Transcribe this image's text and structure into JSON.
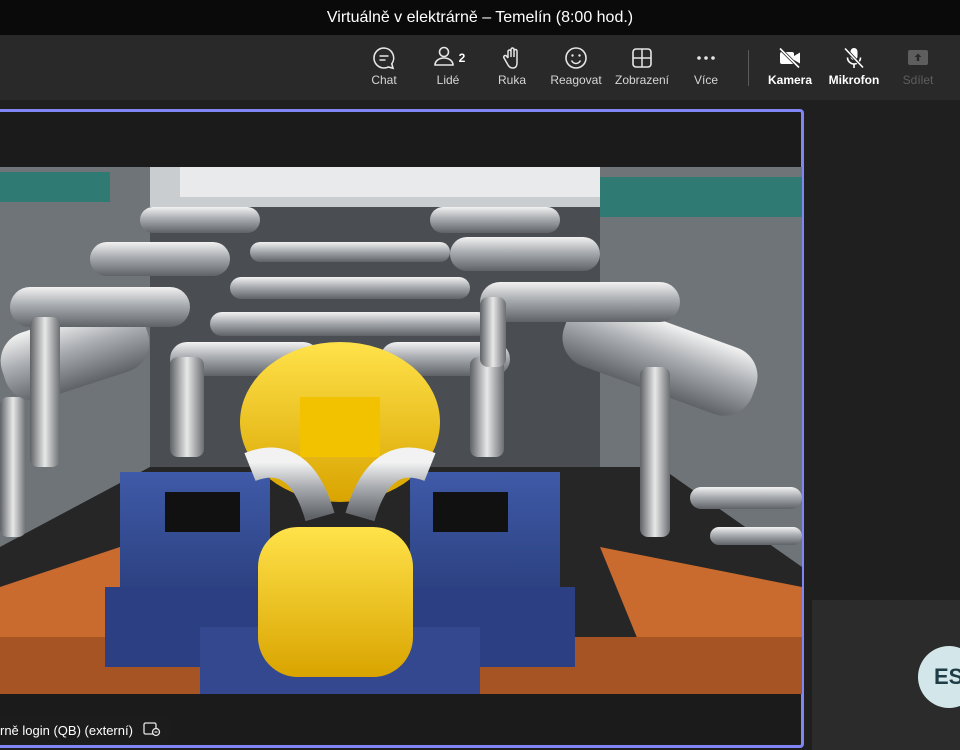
{
  "window": {
    "title": "Virtuálně v elektrárně – Temelín (8:00 hod.)"
  },
  "toolbar": {
    "chat_label": "Chat",
    "people_label": "Lidé",
    "people_count": "2",
    "raise_hand_label": "Ruka",
    "react_label": "Reagovat",
    "view_label": "Zobrazení",
    "more_label": "Více",
    "camera_label": "Kamera",
    "mic_label": "Mikrofon",
    "share_label": "Sdílet"
  },
  "icons": {
    "chat": "chat-bubble-icon",
    "people": "people-icon",
    "hand": "raise-hand-icon",
    "react": "smiley-icon",
    "view": "grid-view-icon",
    "more": "ellipsis-icon",
    "camera": "camera-off-icon",
    "mic": "mic-off-icon",
    "share": "share-tray-icon",
    "pin": "pin-icon"
  },
  "colors": {
    "active_speaker_border": "#7f85f5",
    "avatar_bg": "#d3e6ea",
    "avatar_text": "#1d3c45",
    "disabled_text": "#5e5e5e"
  },
  "participant": {
    "name_tag": "rně login (QB) (externí)",
    "avatar_initials": "ES"
  }
}
